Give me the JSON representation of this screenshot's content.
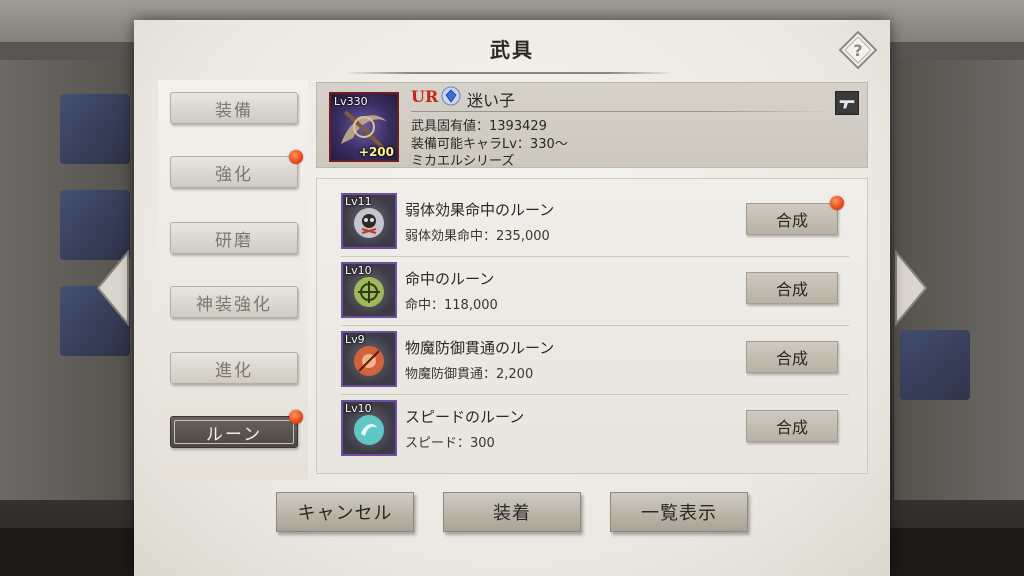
{
  "dialog": {
    "title": "武具"
  },
  "tabs": [
    {
      "label": "装備",
      "active": false,
      "badge": false
    },
    {
      "label": "強化",
      "active": false,
      "badge": true
    },
    {
      "label": "研磨",
      "active": false,
      "badge": false
    },
    {
      "label": "神装強化",
      "active": false,
      "badge": false
    },
    {
      "label": "進化",
      "active": false,
      "badge": false
    },
    {
      "label": "ルーン",
      "active": true,
      "badge": true
    }
  ],
  "weapon": {
    "level": "Lv330",
    "plus": "+200",
    "rarity": "UR",
    "name": "迷い子",
    "unique_value": "武具固有値：1393429",
    "equip_level": "装備可能キャラLv：330～",
    "series": "ミカエルシリーズ"
  },
  "runes": [
    {
      "level": "Lv11",
      "name": "弱体効果命中のルーン",
      "stat": "弱体効果命中：235,000",
      "button": "合成",
      "badge": true,
      "color": "#c7c2cf"
    },
    {
      "level": "Lv10",
      "name": "命中のルーン",
      "stat": "命中：118,000",
      "button": "合成",
      "badge": false,
      "color": "#9fb85a"
    },
    {
      "level": "Lv9",
      "name": "物魔防御貫通のルーン",
      "stat": "物魔防御貫通：2,200",
      "button": "合成",
      "badge": false,
      "color": "#d0623e"
    },
    {
      "level": "Lv10",
      "name": "スピードのルーン",
      "stat": "スピード：300",
      "button": "合成",
      "badge": false,
      "color": "#5fc7c6"
    }
  ],
  "footer": {
    "cancel": "キャンセル",
    "equip": "装着",
    "list": "一覧表示"
  },
  "icons": {
    "help": "question-diamond-icon",
    "weapon_type": "gun-icon",
    "rarity_gem": "blue-gem-icon"
  },
  "colors": {
    "badge": "#ef4b1c",
    "rarity_text": "#c0261b",
    "active_tab": "#4c4741"
  }
}
